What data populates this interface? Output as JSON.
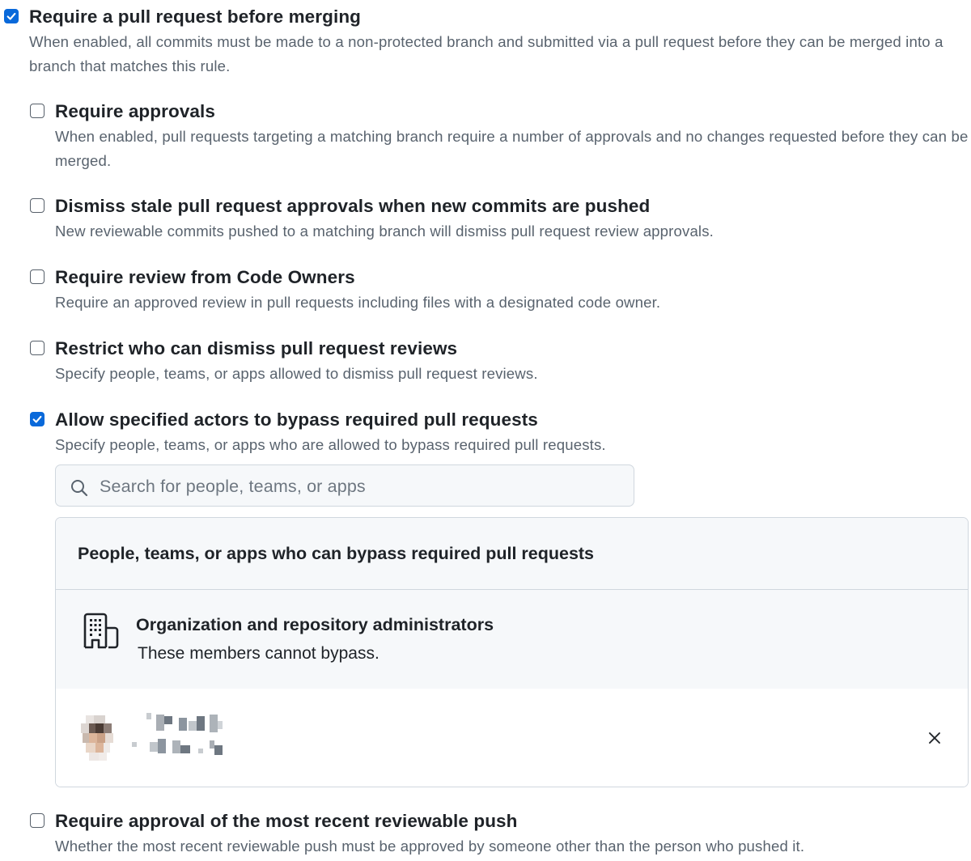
{
  "rules": [
    {
      "checked": true,
      "title": "Require a pull request before merging",
      "description": "When enabled, all commits must be made to a non-protected branch and submitted via a pull request before they can be merged into a branch that matches this rule."
    },
    {
      "checked": false,
      "title": "Require approvals",
      "description": "When enabled, pull requests targeting a matching branch require a number of approvals and no changes requested before they can be merged."
    },
    {
      "checked": false,
      "title": "Dismiss stale pull request approvals when new commits are pushed",
      "description": "New reviewable commits pushed to a matching branch will dismiss pull request review approvals."
    },
    {
      "checked": false,
      "title": "Require review from Code Owners",
      "description": "Require an approved review in pull requests including files with a designated code owner."
    },
    {
      "checked": false,
      "title": "Restrict who can dismiss pull request reviews",
      "description": "Specify people, teams, or apps allowed to dismiss pull request reviews."
    },
    {
      "checked": true,
      "title": "Allow specified actors to bypass required pull requests",
      "description": "Specify people, teams, or apps who are allowed to bypass required pull requests."
    },
    {
      "checked": false,
      "title": "Require approval of the most recent reviewable push",
      "description": "Whether the most recent reviewable push must be approved by someone other than the person who pushed it."
    }
  ],
  "bypass": {
    "search_placeholder": "Search for people, teams, or apps",
    "panel_title": "People, teams, or apps who can bypass required pull requests",
    "admins_title": "Organization and repository administrators",
    "admins_note": "These members cannot bypass."
  },
  "icons": {
    "checkbox_checked": "checkmark-icon",
    "search": "search-icon",
    "admins": "organization-icon",
    "remove": "close-icon"
  },
  "colors": {
    "accent": "#0969da",
    "text": "#1f2328",
    "muted": "#59636e",
    "border": "#d0d7de",
    "subtle_bg": "#f6f8fa"
  }
}
